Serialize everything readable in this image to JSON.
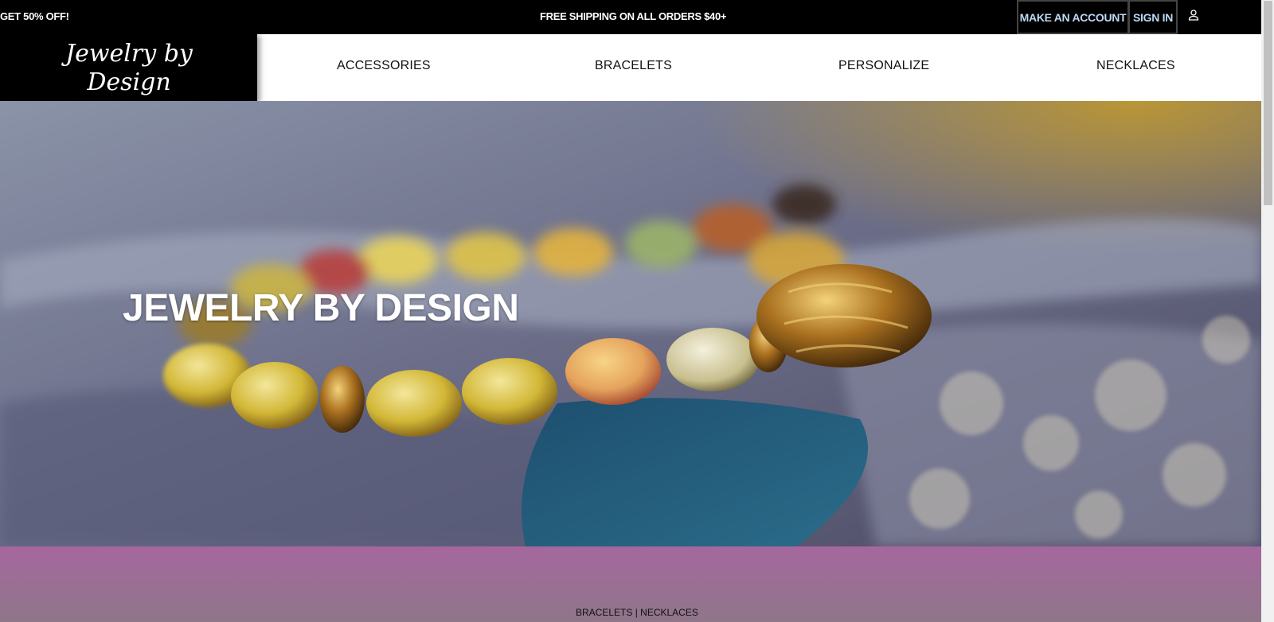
{
  "topbar": {
    "promo": "GET 50% OFF!",
    "shipping": "FREE SHIPPING ON ALL ORDERS $40+",
    "make_account": "MAKE AN ACCOUNT",
    "sign_in": "SIGN IN"
  },
  "logo": {
    "text": "Jewelry by Design"
  },
  "nav": {
    "items": [
      "ACCESSORIES",
      "BRACELETS",
      "PERSONALIZE",
      "NECKLACES"
    ]
  },
  "hero": {
    "title": "JEWELRY BY DESIGN"
  },
  "band": {
    "link_bracelets": "BRACELETS",
    "separator": " | ",
    "link_necklaces": "NECKLACES"
  },
  "colors": {
    "topbar_bg": "#000000",
    "account_link": "#bcd9f5",
    "band": "#a5679e"
  }
}
